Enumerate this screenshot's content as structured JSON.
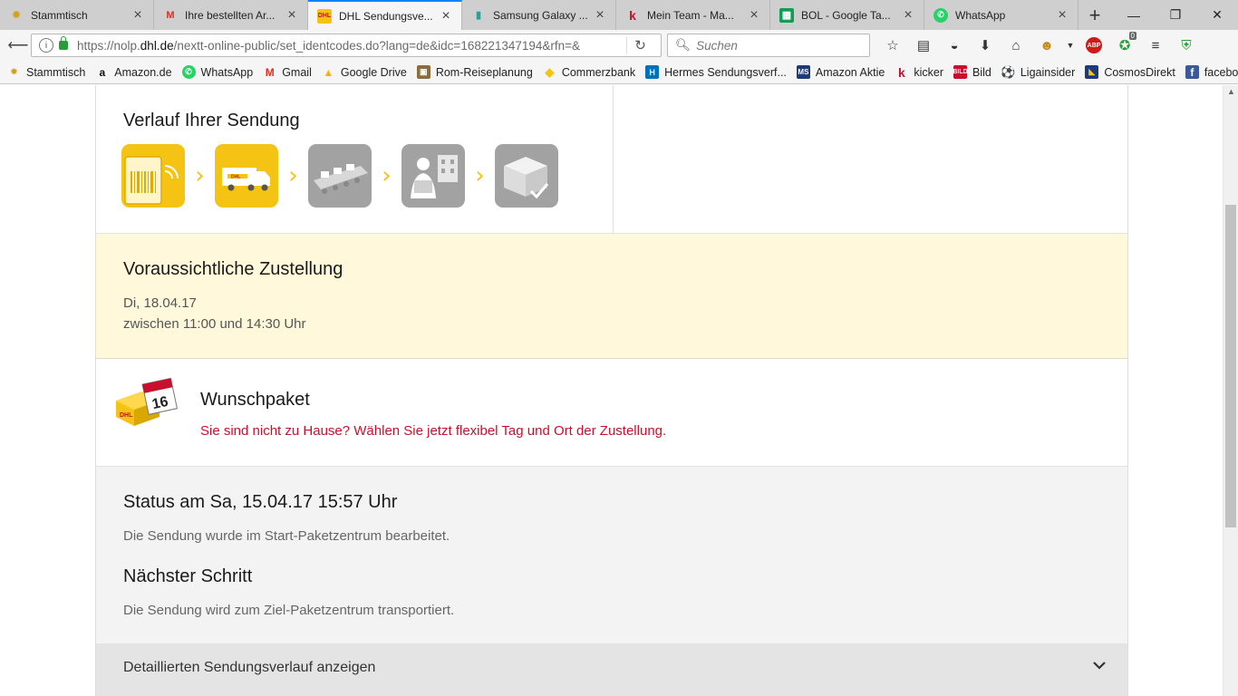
{
  "browser": {
    "tabs": [
      {
        "title": "Stammtisch",
        "icon": "sun-icon"
      },
      {
        "title": "Ihre bestellten Ar...",
        "icon": "gmail-icon"
      },
      {
        "title": "DHL Sendungsve...",
        "icon": "dhl-icon"
      },
      {
        "title": "Samsung Galaxy ...",
        "icon": "page-icon"
      },
      {
        "title": "Mein Team - Ma...",
        "icon": "kicker-icon"
      },
      {
        "title": "BOL - Google Ta...",
        "icon": "sheets-icon"
      },
      {
        "title": "WhatsApp",
        "icon": "whatsapp-icon"
      }
    ],
    "url_prefix": "https://nolp.",
    "url_domain": "dhl.de",
    "url_rest": "/nextt-online-public/set_identcodes.do?lang=de&idc=168221347194&rfn=&",
    "search_placeholder": "Suchen",
    "abp_label": "ABP",
    "badge_count": "0",
    "bookmarks": [
      {
        "label": "Stammtisch",
        "icon": "sun-icon"
      },
      {
        "label": "Amazon.de",
        "icon": "amazon-icon"
      },
      {
        "label": "WhatsApp",
        "icon": "whatsapp-icon"
      },
      {
        "label": "Gmail",
        "icon": "gmail-icon"
      },
      {
        "label": "Google Drive",
        "icon": "drive-icon"
      },
      {
        "label": "Rom-Reiseplanung",
        "icon": "photo-icon"
      },
      {
        "label": "Commerzbank",
        "icon": "commerzbank-icon"
      },
      {
        "label": "Hermes Sendungsverf...",
        "icon": "hermes-icon"
      },
      {
        "label": "Amazon Aktie",
        "icon": "ms-icon"
      },
      {
        "label": "kicker",
        "icon": "kicker-icon"
      },
      {
        "label": "Bild",
        "icon": "bild-icon"
      },
      {
        "label": "Ligainsider",
        "icon": "ball-icon"
      },
      {
        "label": "CosmosDirekt",
        "icon": "cosmos-icon"
      },
      {
        "label": "facebook",
        "icon": "facebook-icon"
      }
    ]
  },
  "page": {
    "progress_title": "Verlauf Ihrer Sendung",
    "steps": [
      {
        "name": "step-registered-icon",
        "state": "done"
      },
      {
        "name": "step-transport-icon",
        "state": "done"
      },
      {
        "name": "step-sorting-icon",
        "state": "pending"
      },
      {
        "name": "step-courier-icon",
        "state": "pending"
      },
      {
        "name": "step-delivered-icon",
        "state": "pending"
      }
    ],
    "delivery_title": "Voraussichtliche Zustellung",
    "delivery_date": "Di, 18.04.17",
    "delivery_window": "zwischen 11:00 und 14:30 Uhr",
    "wunsch_title": "Wunschpaket",
    "wunsch_link": "Sie sind nicht zu Hause? Wählen Sie jetzt flexibel Tag und Ort der Zustellung.",
    "calendar_day": "16",
    "status_title": "Status am Sa, 15.04.17 15:57 Uhr",
    "status_text": "Die Sendung wurde im Start-Paketzentrum bearbeitet.",
    "next_title": "Nächster Schritt",
    "next_text": "Die Sendung wird zum Ziel-Paketzentrum transportiert.",
    "detail_toggle": "Detaillierten Sendungsverlauf anzeigen"
  },
  "colors": {
    "dhl_yellow": "#f4c313",
    "step_grey": "#a2a2a2",
    "link_red": "#c8102e",
    "delivery_bg": "#fff8da"
  }
}
